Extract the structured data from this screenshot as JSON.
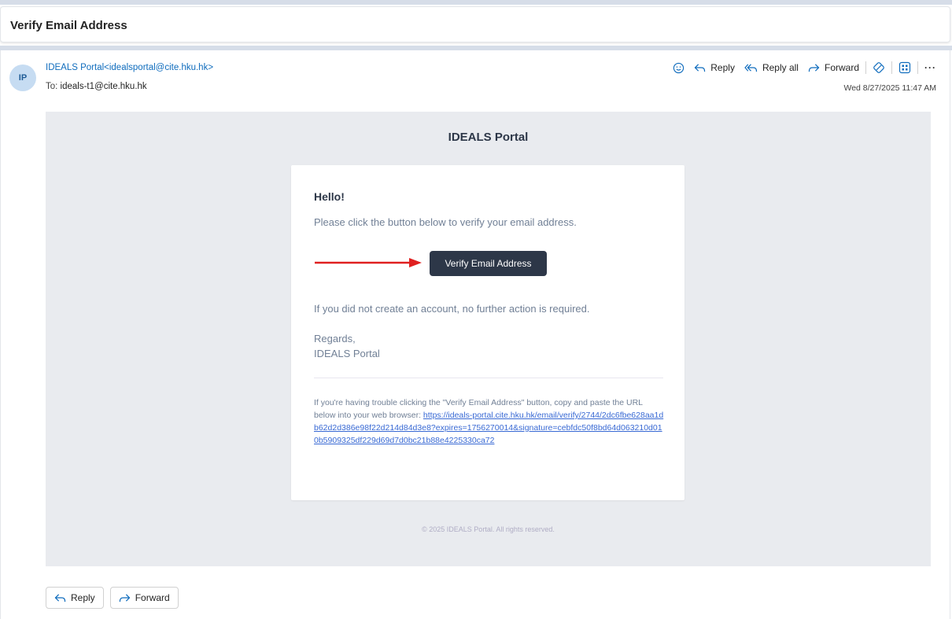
{
  "subject": "Verify Email Address",
  "sender": {
    "initials": "IP",
    "display": "IDEALS Portal<idealsportal@cite.hku.hk>",
    "to_label": "To:",
    "to_value": "ideals-t1@cite.hku.hk",
    "date": "Wed 8/27/2025 11:47 AM"
  },
  "actions": {
    "reply": "Reply",
    "reply_all": "Reply all",
    "forward": "Forward",
    "more": "···"
  },
  "email": {
    "brand": "IDEALS Portal",
    "greeting": "Hello!",
    "intro": "Please click the button below to verify your email address.",
    "button": "Verify Email Address",
    "outro": "If you did not create an account, no further action is required.",
    "regards": "Regards,",
    "signature": "IDEALS Portal",
    "trouble_text": "If you're having trouble clicking the \"Verify Email Address\" button, copy and paste the URL below into your web browser: ",
    "url": "https://ideals-portal.cite.hku.hk/email/verify/2744/2dc6fbe628aa1db62d2d386e98f22d214d84d3e8?expires=1756270014&signature=cebfdc50f8bd64d063210d010b5909325df229d69d7d0bc21b88e4225330ca72",
    "copyright": "© 2025 IDEALS Portal. All rights reserved."
  },
  "bottom": {
    "reply": "Reply",
    "forward": "Forward"
  },
  "colors": {
    "accent": "#0f6cbd",
    "button_bg": "#2d3748",
    "annotation_arrow": "#e02020",
    "link": "#3869d4"
  },
  "icons": [
    "emoji-icon",
    "reply-icon",
    "reply-all-icon",
    "forward-icon",
    "sensitivity-icon",
    "apps-icon",
    "more-icon"
  ]
}
